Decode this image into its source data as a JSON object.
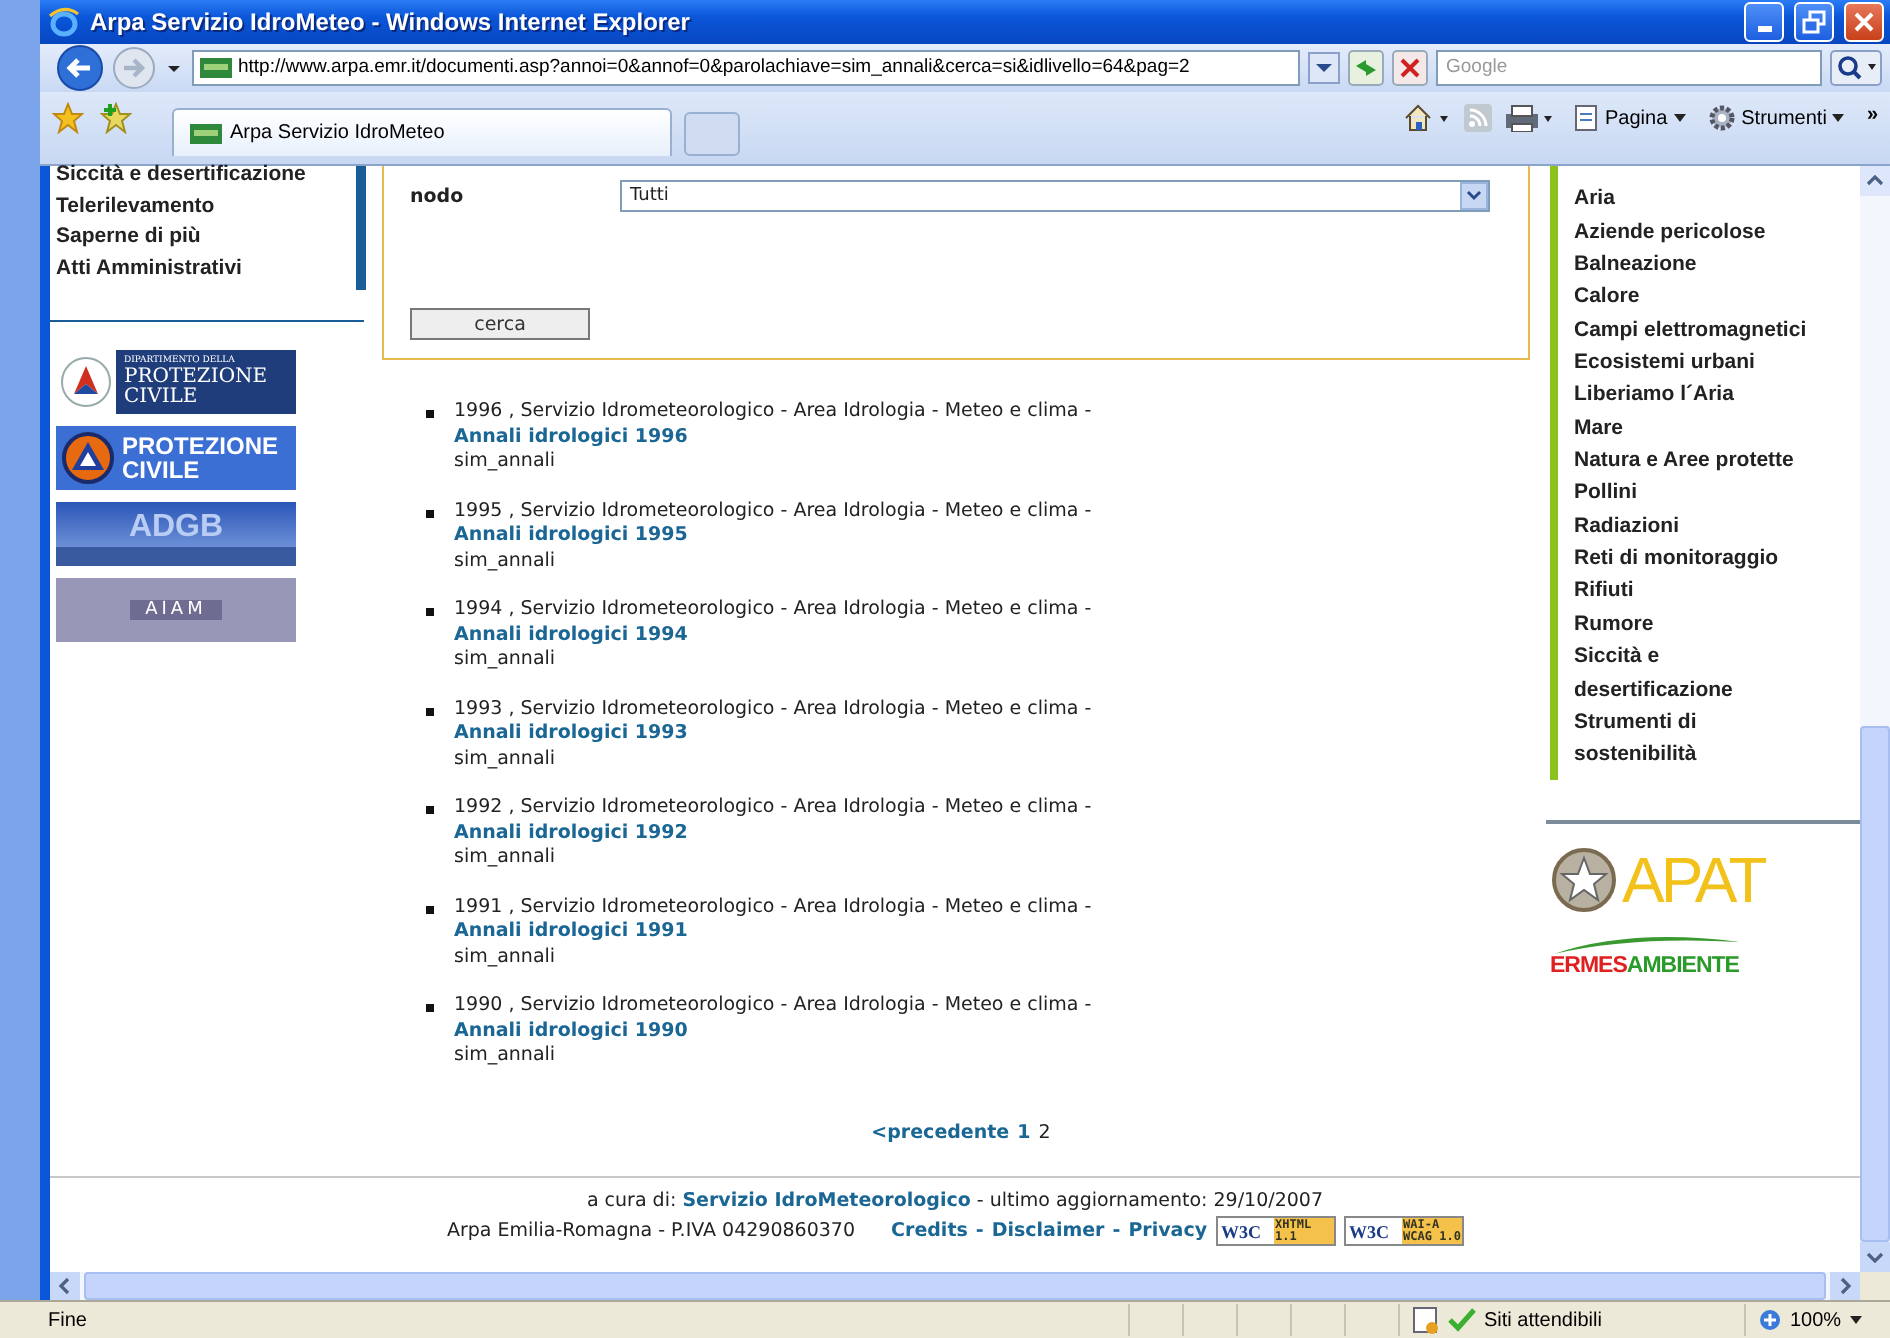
{
  "window": {
    "title": "Arpa Servizio IdroMeteo - Windows Internet Explorer"
  },
  "address_bar": {
    "url": "http://www.arpa.emr.it/documenti.asp?annoi=0&annof=0&parolachiave=sim_annali&cerca=si&idlivello=64&pag=2",
    "search_placeholder": "Google"
  },
  "tabs": [
    {
      "label": "Arpa Servizio IdroMeteo",
      "selected": true
    }
  ],
  "command_bar": {
    "items": [
      "Pagina",
      "Strumenti"
    ],
    "overflow": "»"
  },
  "left_menu": {
    "items": [
      "Siccità e desertificazione",
      "Telerilevamento",
      "Saperne di più",
      "Atti Amministrativi"
    ]
  },
  "left_banners": [
    {
      "kind": "dpc",
      "lines": [
        "DIPARTIMENTO DELLA",
        "PROTEZIONE",
        "CIVILE"
      ]
    },
    {
      "kind": "pc",
      "lines": [
        "PROTEZIONE",
        "CIVILE"
      ]
    },
    {
      "kind": "adgb",
      "lines": [
        "ADGB"
      ]
    },
    {
      "kind": "aiam",
      "lines": [
        "AIAM"
      ]
    }
  ],
  "search_form": {
    "label": "nodo",
    "select_value": "Tutti",
    "button": "cerca"
  },
  "results": [
    {
      "description": "1996 ,  Servizio Idrometeorologico - Area Idrologia - Meteo e clima -",
      "link": "Annali idrologici 1996",
      "keyword": "sim_annali"
    },
    {
      "description": "1995 ,  Servizio Idrometeorologico - Area Idrologia - Meteo e clima -",
      "link": "Annali idrologici 1995",
      "keyword": "sim_annali"
    },
    {
      "description": "1994 ,  Servizio Idrometeorologico - Area Idrologia - Meteo e clima -",
      "link": "Annali idrologici 1994",
      "keyword": "sim_annali"
    },
    {
      "description": "1993 ,  Servizio Idrometeorologico - Area Idrologia - Meteo e clima -",
      "link": "Annali idrologici 1993",
      "keyword": "sim_annali"
    },
    {
      "description": "1992 ,  Servizio Idrometeorologico - Area Idrologia - Meteo e clima -",
      "link": "Annali idrologici 1992",
      "keyword": "sim_annali"
    },
    {
      "description": "1991 ,  Servizio Idrometeorologico - Area Idrologia - Meteo e clima -",
      "link": "Annali idrologici 1991",
      "keyword": "sim_annali"
    },
    {
      "description": "1990 ,  Servizio Idrometeorologico - Area Idrologia - Meteo e clima -",
      "link": "Annali idrologici 1990",
      "keyword": "sim_annali"
    }
  ],
  "pagination": {
    "previous": "<precedente",
    "pages": [
      {
        "label": "1",
        "selected": false
      },
      {
        "label": "2",
        "selected": true
      }
    ]
  },
  "right_menu": {
    "items": [
      "Aria",
      "Aziende pericolose",
      "Balneazione",
      "Calore",
      "Campi elettromagnetici",
      "Ecosistemi urbani",
      "Liberiamo l´Aria",
      "Mare",
      "Natura e Aree protette",
      "Pollini",
      "Radiazioni",
      "Reti di monitoraggio",
      "Rifiuti",
      "Rumore",
      "Siccità e desertificazione",
      "Strumenti di sostenibilità"
    ]
  },
  "right_logos": {
    "apat": "APAT",
    "ermes_parts": [
      "ERMES",
      "AMBIENTE"
    ]
  },
  "footer": {
    "curated_by": "a cura di:",
    "curator_link": "Servizio IdroMeteorologico",
    "updated": "- ultimo aggiornamento: 29/10/2007",
    "company": "Arpa Emilia-Romagna - P.IVA 04290860370",
    "links": [
      "Credits",
      "Disclaimer",
      "Privacy"
    ],
    "separator": "-",
    "badges": [
      {
        "logo": "W3C",
        "lines": [
          "XHTML",
          "1.1"
        ]
      },
      {
        "logo": "W3C",
        "lines": [
          "WAI-A",
          "WCAG 1.0"
        ]
      }
    ]
  },
  "status_bar": {
    "text": "Fine",
    "zone": "Siti attendibili",
    "zoom": "100%"
  }
}
